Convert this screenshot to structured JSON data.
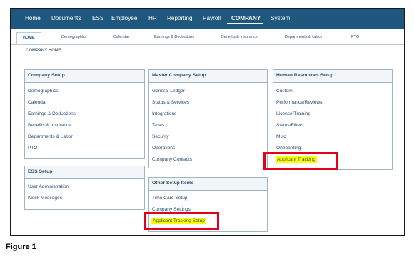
{
  "topnav": {
    "items": [
      "Home",
      "Documents",
      "ESS",
      "Employee",
      "HR",
      "Reporting",
      "Payroll",
      "COMPANY",
      "System"
    ],
    "active": "COMPANY"
  },
  "subtabs": [
    "HOME",
    "Demographics",
    "Calendar",
    "Earnings & Deductions",
    "Benefits & Insurance",
    "Departments & Labor",
    "PTO"
  ],
  "page_title": "COMPANY HOME",
  "panels": {
    "company_setup": {
      "title": "Company Setup",
      "links": [
        "Demographics",
        "Calendar",
        "Earnings & Deductions",
        "Benefits & Insurance",
        "Departments & Labor",
        "PTO"
      ]
    },
    "ess_setup": {
      "title": "ESS Setup",
      "links": [
        "User Administration",
        "Kiosk Messages"
      ]
    },
    "master_company_setup": {
      "title": "Master Company Setup",
      "links": [
        "General Ledger",
        "Status & Services",
        "Integrations",
        "Taxes",
        "Security",
        "Operations",
        "Company Contacts"
      ]
    },
    "other_setup_items": {
      "title": "Other Setup Items",
      "links": [
        "Time Card Setup",
        "Company Settings",
        "Applicant Tracking Setup"
      ]
    },
    "hr_setup": {
      "title": "Human Resources Setup",
      "links": [
        "Custom",
        "Performance/Reviews",
        "License/Training",
        "Status/Filters",
        "Misc",
        "Onboarding",
        "Applicant Tracking"
      ]
    }
  },
  "highlight_color": "#ffff00",
  "annotation_color": "#e3001b",
  "caption": "Figure 1"
}
